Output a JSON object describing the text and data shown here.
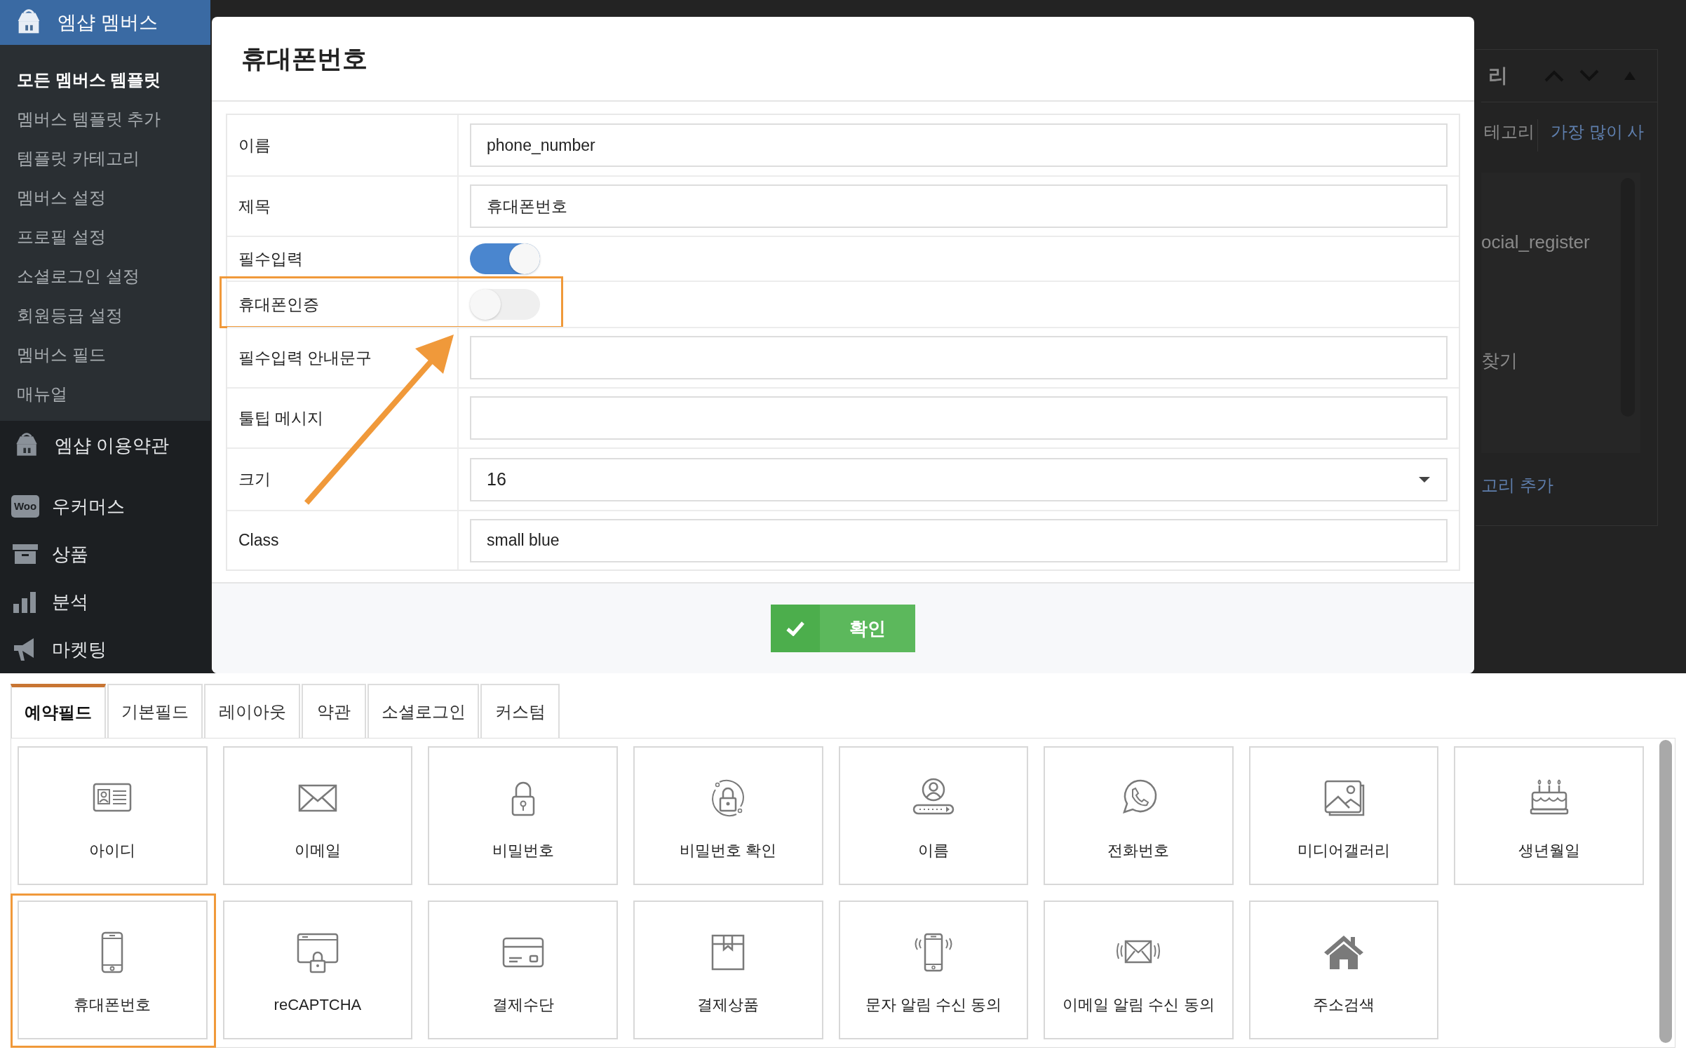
{
  "sidebar": {
    "header": {
      "label": "엠샵 멤버스"
    },
    "submenu": [
      {
        "label": "모든 멤버스 템플릿",
        "selected": true
      },
      {
        "label": "멤버스 템플릿 추가",
        "selected": false
      },
      {
        "label": "템플릿 카테고리",
        "selected": false
      },
      {
        "label": "멤버스 설정",
        "selected": false
      },
      {
        "label": "프로필 설정",
        "selected": false
      },
      {
        "label": "소셜로그인 설정",
        "selected": false
      },
      {
        "label": "회원등급 설정",
        "selected": false
      },
      {
        "label": "멤버스 필드",
        "selected": false
      },
      {
        "label": "매뉴얼",
        "selected": false
      }
    ],
    "menu": [
      {
        "label": "엠샵 이용약관",
        "kind": "shop"
      },
      {
        "label": "우커머스",
        "kind": "woo",
        "icon_text": "Woo"
      },
      {
        "label": "상품",
        "kind": "archive"
      },
      {
        "label": "분석",
        "kind": "chart"
      },
      {
        "label": "마켓팅",
        "kind": "megaphone"
      }
    ]
  },
  "background_panel": {
    "title": "리",
    "tabs": [
      {
        "label": "테고리",
        "selected": true
      },
      {
        "label": "가장 많이 사",
        "selected": false
      }
    ],
    "items": [
      "ocial_register",
      "찾기"
    ],
    "add_link": "고리 추가"
  },
  "dialog": {
    "title": "휴대폰번호",
    "rows": [
      {
        "label": "이름",
        "kind": "text",
        "value": "phone_number",
        "highlighted": false
      },
      {
        "label": "제목",
        "kind": "text",
        "value": "휴대폰번호",
        "highlighted": false
      },
      {
        "label": "필수입력",
        "kind": "toggle",
        "on": true,
        "highlighted": false
      },
      {
        "label": "휴대폰인증",
        "kind": "toggle",
        "on": false,
        "highlighted": true
      },
      {
        "label": "필수입력 안내문구",
        "kind": "text",
        "highlighted": false
      },
      {
        "label": "툴팁 메시지",
        "kind": "text",
        "highlighted": false
      },
      {
        "label": "크기",
        "kind": "select",
        "value": "16",
        "highlighted": false
      },
      {
        "label": "Class",
        "kind": "text",
        "value": "small blue",
        "highlighted": false
      }
    ],
    "confirm_button": "확인"
  },
  "field_palette": {
    "tabs": [
      {
        "label": "예약필드",
        "selected": true
      },
      {
        "label": "기본필드",
        "selected": false
      },
      {
        "label": "레이아웃",
        "selected": false
      },
      {
        "label": "약관",
        "selected": false
      },
      {
        "label": "소셜로그인",
        "selected": false
      },
      {
        "label": "커스텀",
        "selected": false
      }
    ],
    "tiles": [
      {
        "label": "아이디",
        "highlighted": false
      },
      {
        "label": "이메일",
        "highlighted": false
      },
      {
        "label": "비밀번호",
        "highlighted": false
      },
      {
        "label": "비밀번호 확인",
        "highlighted": false
      },
      {
        "label": "이름",
        "highlighted": false
      },
      {
        "label": "전화번호",
        "highlighted": false
      },
      {
        "label": "미디어갤러리",
        "highlighted": false
      },
      {
        "label": "생년월일",
        "highlighted": false
      },
      {
        "label": "휴대폰번호",
        "highlighted": true
      },
      {
        "label": "reCAPTCHA",
        "highlighted": false
      },
      {
        "label": "결제수단",
        "highlighted": false
      },
      {
        "label": "결제상품",
        "highlighted": false
      },
      {
        "label": "문자 알림 수신 동의",
        "highlighted": false
      },
      {
        "label": "이메일 알림 수신 동의",
        "highlighted": false
      },
      {
        "label": "주소검색",
        "highlighted": false
      }
    ]
  }
}
